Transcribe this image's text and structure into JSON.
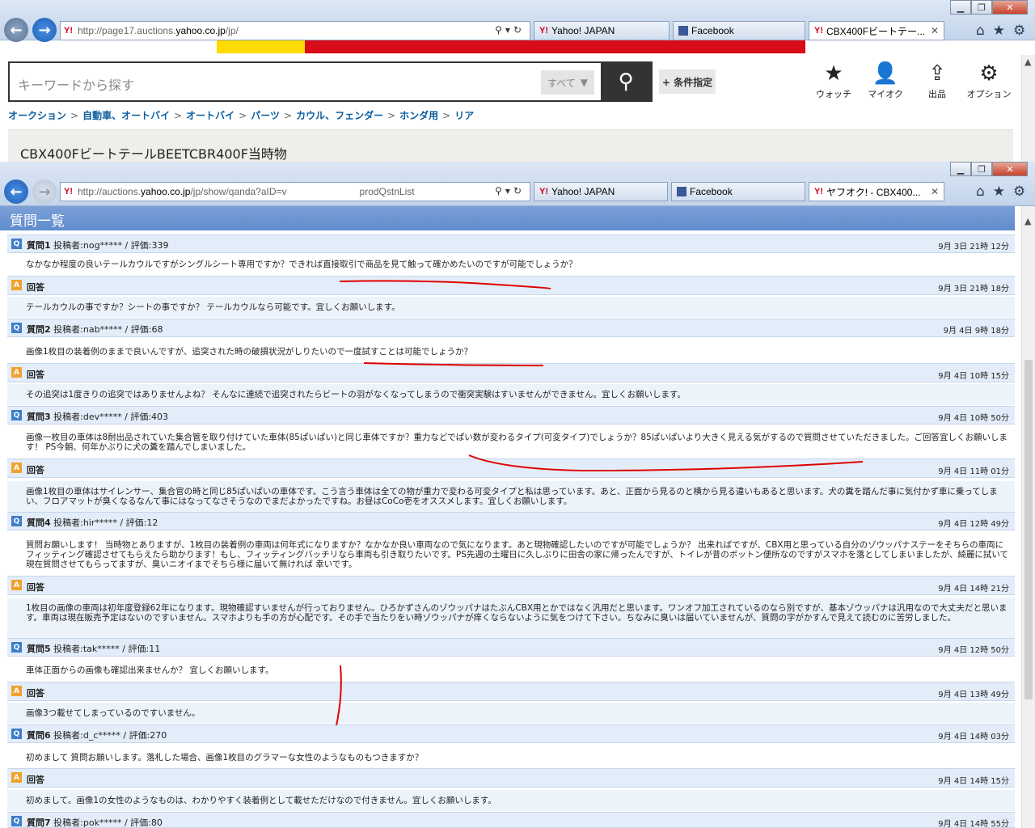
{
  "window1": {
    "url_prefix": "http://page17.auctions.",
    "url_domain": "yahoo.co.jp",
    "url_suffix": "/jp/",
    "tab1": "Yahoo! JAPAN",
    "tab2": "Facebook",
    "tab3": "CBX400Fビートテー..."
  },
  "window2": {
    "url_prefix": "http://auctions.",
    "url_domain": "yahoo.co.jp",
    "url_suffix": "/jp/show/qanda?aID=v",
    "url_tail": "prodQstnList",
    "tab1": "Yahoo! JAPAN",
    "tab2": "Facebook",
    "tab3": "ヤフオク! - CBX400..."
  },
  "search": {
    "placeholder": "キーワードから探す",
    "category": "すべて",
    "condition": "+ 条件指定"
  },
  "header_buttons": {
    "watch": "ウォッチ",
    "myauction": "マイオク",
    "sell": "出品",
    "options": "オプション"
  },
  "breadcrumb": [
    "オークション",
    "自動車、オートバイ",
    "オートバイ",
    "パーツ",
    "カウル、フェンダー",
    "ホンダ用",
    "リア"
  ],
  "item_title": "CBX400FビートテールBEETCBR400F当時物",
  "qa": {
    "heading": "質問一覧",
    "answer_label": "回答",
    "items": [
      {
        "q_label": "質問1",
        "meta": "投稿者:nog***** / 評価:339",
        "q_date": "9月 3日 21時 12分",
        "q_text": "なかなか程度の良いテールカウルですがシングルシート専用ですか？できれば直接取引で商品を見て触って確かめたいのですが可能でしょうか？",
        "a_date": "9月 3日 21時 18分",
        "a_text": "テールカウルの事ですか？シートの事ですか？ テールカウルなら可能です。宜しくお願いします。"
      },
      {
        "q_label": "質問2",
        "meta": "投稿者:nab***** / 評価:68",
        "q_date": "9月 4日 9時 18分",
        "q_text": "画像1枚目の装着例のままで良いんですが、追突された時の破損状況がしりたいので一度試すことは可能でしょうか？",
        "a_date": "9月 4日 10時 15分",
        "a_text": "その追突は1度きりの追突ではありませんよね？ そんなに連続で追突されたらビートの羽がなくなってしまうので衝突実験はすいませんができません。宜しくお願いします。"
      },
      {
        "q_label": "質問3",
        "meta": "投稿者:dev***** / 評価:403",
        "q_date": "9月 4日 10時 50分",
        "q_text": "画像一枚目の車体は8耐出品されていた集合管を取り付けていた車体(85ぱいぱい)と同じ車体ですか？重力などでぱい数が変わるタイプ(可変タイプ)でしょうか？85ぱいぱいより大きく見える気がするので質問させていただきました。ご回答宜しくお願いします！ PS今朝、何年かぶりに犬の糞を踏んでしまいました。",
        "a_date": "9月 4日 11時 01分",
        "a_text": "画像1枚目の車体はサイレンサー、集合官の時と同じ85ぱいぱいの車体です。こう言う車体は全ての物が重力で変わる可変タイプと私は思っています。あと、正面から見るのと横から見る違いもあると思います。犬の糞を踏んだ事に気付かず車に乗ってしまい、フロアマットが臭くなるなんて事にはなってなさそうなのでまだよかったですね。お昼はCoCo壱をオススメします。宜しくお願いします。"
      },
      {
        "q_label": "質問4",
        "meta": "投稿者:hir***** / 評価:12",
        "q_date": "9月 4日 12時 49分",
        "q_text": "質問お願いします！ 当時物とありますが、1枚目の装着例の車両は何年式になりますか？なかなか良い車両なので気になります。あと現物確認したいのですが可能でしょうか？ 出来ればですが、CBX用と思っている自分のゾウッパナステーをそちらの車両にフィッティング確認させてもらえたら助かります！もし、フィッティングバッチリなら車両も引き取りたいです。PS先週の土曜日に久しぶりに田舎の家に帰ったんですが、トイレが昔のボットン便所なのですがスマホを落としてしまいましたが、綺麗に拭いて現在質問させてもらってますが、臭いニオイまでそちら様に届いて無ければ 幸いです。",
        "a_date": "9月 4日 14時 21分",
        "a_text": "1枚目の画像の車両は初年度登録62年になります。現物確認すいませんが行っておりません。ひろかずさんのゾウッパナはたぶんCBX用とかではなく汎用だと思います。ワンオフ加工されているのなら別ですが、基本ゾウッパナは汎用なので大丈夫だと思います。車両は現在販売予定はないのですいません。スマホよりも手の方が心配です。その手で当たりをい時ゾウッパナが痒くならないように気をつけて下さい。ちなみに臭いは届いていませんが、質問の字がかすんで見えて読むのに苦労しました。"
      },
      {
        "q_label": "質問5",
        "meta": "投稿者:tak***** / 評価:11",
        "q_date": "9月 4日 12時 50分",
        "q_text": "車体正面からの画像も確認出来ませんか？ 宜しくお願いします。",
        "a_date": "9月 4日 13時 49分",
        "a_text": "画像3つ載せてしまっているのですいません。"
      },
      {
        "q_label": "質問6",
        "meta": "投稿者:d_c***** / 評価:270",
        "q_date": "9月 4日 14時 03分",
        "q_text": "初めまして 質問お願いします。落札した場合、画像1枚目のグラマーな女性のようなものもつきますか？",
        "a_date": "9月 4日 14時 15分",
        "a_text": "初めまして。画像1の女性のようなものは、わかりやすく装着例として載せただけなので付きません。宜しくお願いします。"
      },
      {
        "q_label": "質問7",
        "meta": "投稿者:pok***** / 評価:80",
        "q_date": "9月 4日 14時 55分"
      }
    ]
  },
  "colors": {
    "link": "#0b5d9e",
    "qa_header": "#6b95d2",
    "row_band": "#e3edf9",
    "annotation": "#e00000"
  }
}
